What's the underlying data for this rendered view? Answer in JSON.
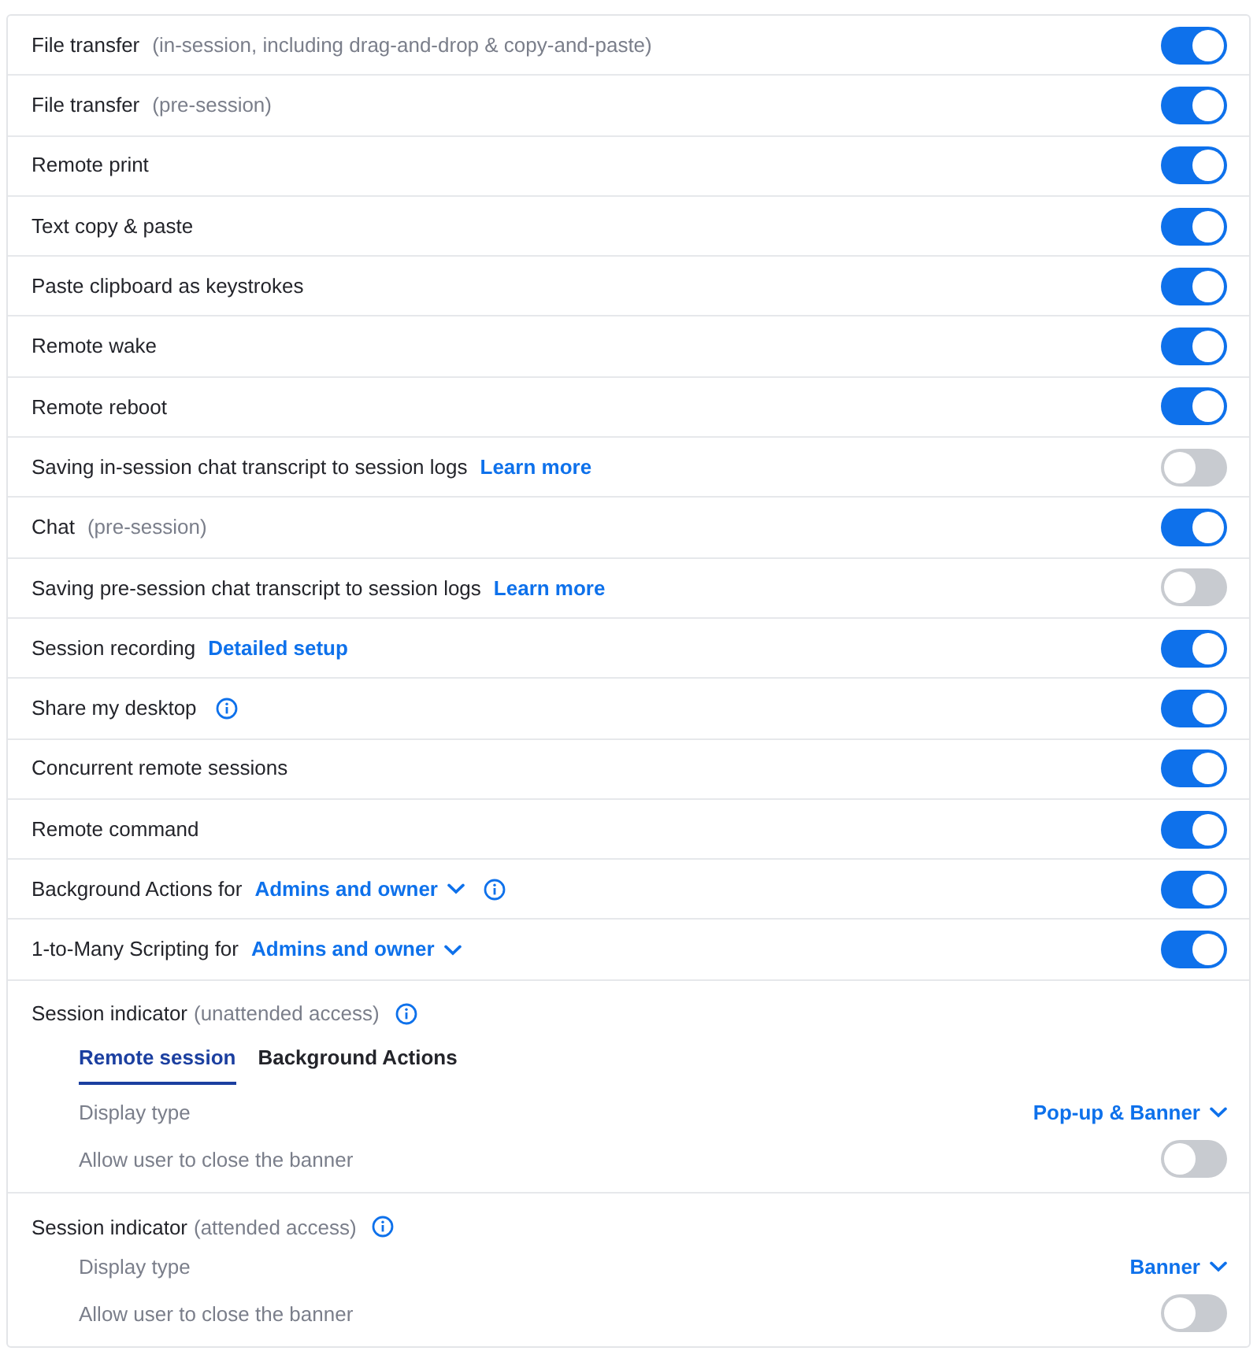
{
  "rows": [
    {
      "label": "File transfer",
      "note": "(in-session, including drag-and-drop & copy-and-paste)",
      "on": true
    },
    {
      "label": "File transfer",
      "note": "(pre-session)",
      "on": true
    },
    {
      "label": "Remote print",
      "on": true
    },
    {
      "label": "Text copy & paste",
      "on": true
    },
    {
      "label": "Paste clipboard as keystrokes",
      "on": true
    },
    {
      "label": "Remote wake",
      "on": true
    },
    {
      "label": "Remote reboot",
      "on": true
    },
    {
      "label": "Saving in-session chat transcript to session logs",
      "link": "Learn more",
      "on": false
    },
    {
      "label": "Chat",
      "note": "(pre-session)",
      "on": true
    },
    {
      "label": "Saving pre-session chat transcript to session logs",
      "link": "Learn more",
      "on": false
    },
    {
      "label": "Session recording",
      "link": "Detailed setup",
      "on": true
    },
    {
      "label": "Share my desktop",
      "info": true,
      "on": true
    },
    {
      "label": "Concurrent remote sessions",
      "on": true
    },
    {
      "label": "Remote command",
      "on": true
    },
    {
      "label": "Background Actions for",
      "dropdown": "Admins and owner",
      "info": true,
      "on": true
    },
    {
      "label": "1-to-Many Scripting for",
      "dropdown": "Admins and owner",
      "on": true
    }
  ],
  "sections": [
    {
      "title": "Session indicator",
      "note": "(unattended access)",
      "info": true,
      "tabs": [
        {
          "label": "Remote session",
          "selected": true
        },
        {
          "label": "Background Actions",
          "selected": false
        }
      ],
      "settings": [
        {
          "kind": "dropdown",
          "label": "Display type",
          "value": "Pop-up & Banner"
        },
        {
          "kind": "toggle",
          "label": "Allow user to close the banner",
          "on": false
        }
      ]
    },
    {
      "title": "Session indicator",
      "note": "(attended access)",
      "info": true,
      "settings": [
        {
          "kind": "dropdown",
          "label": "Display type",
          "value": "Banner"
        },
        {
          "kind": "toggle",
          "label": "Allow user to close the banner",
          "on": false
        }
      ]
    }
  ]
}
